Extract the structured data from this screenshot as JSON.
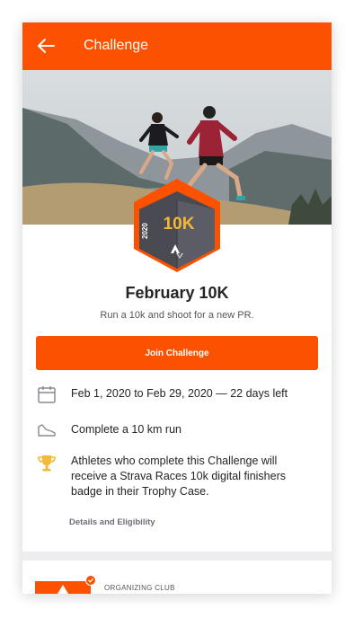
{
  "appbar": {
    "title": "Challenge",
    "back_icon": "arrow-left-icon",
    "color": "#fc5200"
  },
  "badge": {
    "year": "2020",
    "distance": "10K",
    "icon": "strava-logo-icon"
  },
  "challenge": {
    "name": "February 10K",
    "subtitle": "Run a 10k and shoot for a new PR.",
    "join_label": "Join Challenge"
  },
  "details": [
    {
      "icon": "calendar-icon",
      "text": "Feb 1, 2020 to Feb 29, 2020  —  22 days left"
    },
    {
      "icon": "shoe-icon",
      "text": "Complete a 10 km run"
    },
    {
      "icon": "trophy-icon",
      "text": "Athletes who complete this Challenge will receive a Strava Races 10k digital finishers badge in their Trophy Case."
    }
  ],
  "details_link": "Details and Eligibility",
  "club": {
    "label": "ORGANIZING CLUB",
    "icon": "check-icon"
  },
  "colors": {
    "accent": "#fc5200",
    "badge_gold": "#f5b935",
    "trophy": "#f5b935"
  }
}
